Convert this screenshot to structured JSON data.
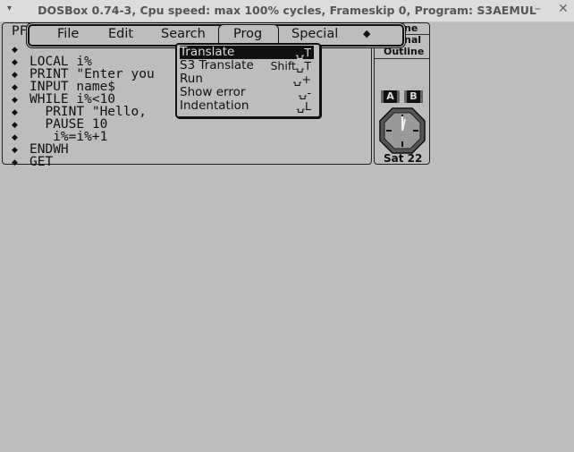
{
  "window": {
    "title": "DOSBox 0.74-3, Cpu speed: max 100% cycles, Frameskip  0, Program:  S3AEMUL",
    "menu_icon": "▾",
    "minimize": "–",
    "close": "✕"
  },
  "editor": {
    "first_line": "PF",
    "bullet": "◆",
    "lines": [
      "",
      "LOCAL i%",
      "PRINT \"Enter you",
      "INPUT name$",
      "WHILE i%<10",
      "  PRINT \"Hello,",
      "  PAUSE 10",
      "   i%=i%+1",
      "ENDWH",
      "GET"
    ]
  },
  "menubar": {
    "items": [
      "File",
      "Edit",
      "Search",
      "Prog",
      "Special",
      "◆"
    ]
  },
  "dropdown": {
    "items": [
      {
        "label": "Translate",
        "shortcut": "⍽T"
      },
      {
        "label": "S3 Translate",
        "shortcut": "Shift⍽T"
      },
      {
        "label": "Run",
        "shortcut": "⍽+"
      },
      {
        "label": "Show error",
        "shortcut": "⍽-"
      },
      {
        "label": "Indentation",
        "shortcut": "⍽L"
      }
    ]
  },
  "side": {
    "line1": "ne",
    "line2": "nal",
    "line3": "Outline",
    "drive_a": "A",
    "drive_b": "B",
    "date": "Sat 22"
  }
}
